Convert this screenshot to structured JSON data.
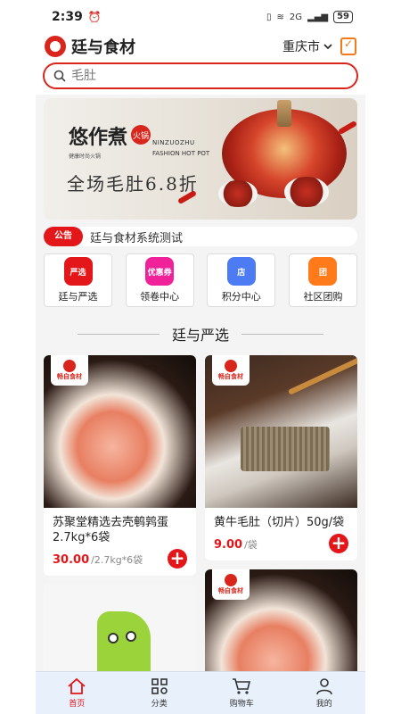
{
  "status": {
    "time": "2:39",
    "battery": "59",
    "network": "2G"
  },
  "header": {
    "brand": "廷与食材",
    "city": "重庆市"
  },
  "search": {
    "placeholder": "毛肚"
  },
  "banner": {
    "brand_text": "悠作煮",
    "badge": "火锅",
    "en_line1": "NINZUOZHU",
    "en_line2": "FASHION HOT POT",
    "cn_subtitle": "健康时尚火锅",
    "promo": "全场毛肚6.8折"
  },
  "notice": {
    "tag": "公告",
    "text": "廷与食材系统测试"
  },
  "quick_entries": [
    {
      "label": "廷与严选",
      "icon_text": "严选",
      "icon": "flame-icon",
      "color": "#e3161a"
    },
    {
      "label": "领卷中心",
      "icon_text": "优惠券",
      "icon": "coupon-icon",
      "color": "#f0229a"
    },
    {
      "label": "积分中心",
      "icon_text": "店",
      "icon": "store-icon",
      "color": "#4d7bf3"
    },
    {
      "label": "社区团购",
      "icon_text": "团",
      "icon": "group-buy-icon",
      "color": "#ff7a1a"
    }
  ],
  "section": {
    "title": "廷与严选"
  },
  "products": [
    {
      "name": "苏聚堂精选去壳鹌鹑蛋2.7kg*6袋",
      "price": "30.00",
      "unit": "/2.7kg*6袋"
    },
    {
      "name": "黄牛毛肚（切片）50g/袋",
      "price": "9.00",
      "unit": "/袋"
    }
  ],
  "card_logo": "畅自食材",
  "tabbar": [
    {
      "label": "首页",
      "icon": "home-icon",
      "active": true
    },
    {
      "label": "分类",
      "icon": "category-icon",
      "active": false
    },
    {
      "label": "购物车",
      "icon": "cart-icon",
      "active": false
    },
    {
      "label": "我的",
      "icon": "user-icon",
      "active": false
    }
  ],
  "colors": {
    "accent": "#e3161a",
    "tabbar_bg": "#e8f0fb"
  }
}
